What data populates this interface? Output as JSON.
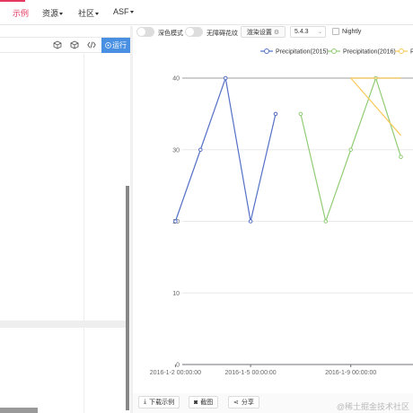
{
  "topnav": {
    "items": [
      {
        "label": "示例",
        "active": true
      },
      {
        "label": "资源",
        "caret": true
      },
      {
        "label": "社区",
        "caret": true
      },
      {
        "label": "ASF",
        "caret": true
      }
    ]
  },
  "editor": {
    "toolbar_icons": [
      "cube-outline-icon",
      "box-icon",
      "code-icon"
    ],
    "run_label": "运行",
    "run_icon": "play-circle-icon"
  },
  "settings": {
    "dark_mode_label": "深色模式",
    "no_decal_label": "无障碍花纹",
    "render_settings_label": "渲染设置",
    "version": "5.4.3",
    "nightly_label": "Nightly"
  },
  "footer": {
    "download_label": "下载示例",
    "screenshot_label": "截图",
    "share_label": "分享",
    "watermark": "@稀土掘金技术社区"
  },
  "chart_data": {
    "type": "line",
    "yticks": [
      "0",
      "10",
      "20",
      "30",
      "40"
    ],
    "ylim": [
      0,
      40
    ],
    "xtick_labels": [
      "2016-1-2 00:00:00",
      "2016-1-5 00:00:00",
      "2016-1-9 00:00:00"
    ],
    "legend": [
      "Precipitation(2015)",
      "Precipitation(2016)",
      "P"
    ],
    "colors": [
      "#5470c6",
      "#91cc75",
      "#fac858"
    ],
    "series": [
      {
        "name": "Precipitation(2015)",
        "x": [
          1,
          2,
          3,
          4,
          5
        ],
        "y": [
          20,
          30,
          40,
          20,
          35
        ]
      },
      {
        "name": "Precipitation(2016)",
        "x": [
          6,
          7,
          8,
          9,
          10
        ],
        "y": [
          35,
          20,
          30,
          40,
          29
        ]
      },
      {
        "name": "P",
        "x": [
          8,
          9,
          10
        ],
        "y": [
          40,
          40,
          40
        ]
      },
      {
        "name": "P",
        "x": [
          8,
          10
        ],
        "y": [
          40,
          32
        ]
      }
    ]
  }
}
